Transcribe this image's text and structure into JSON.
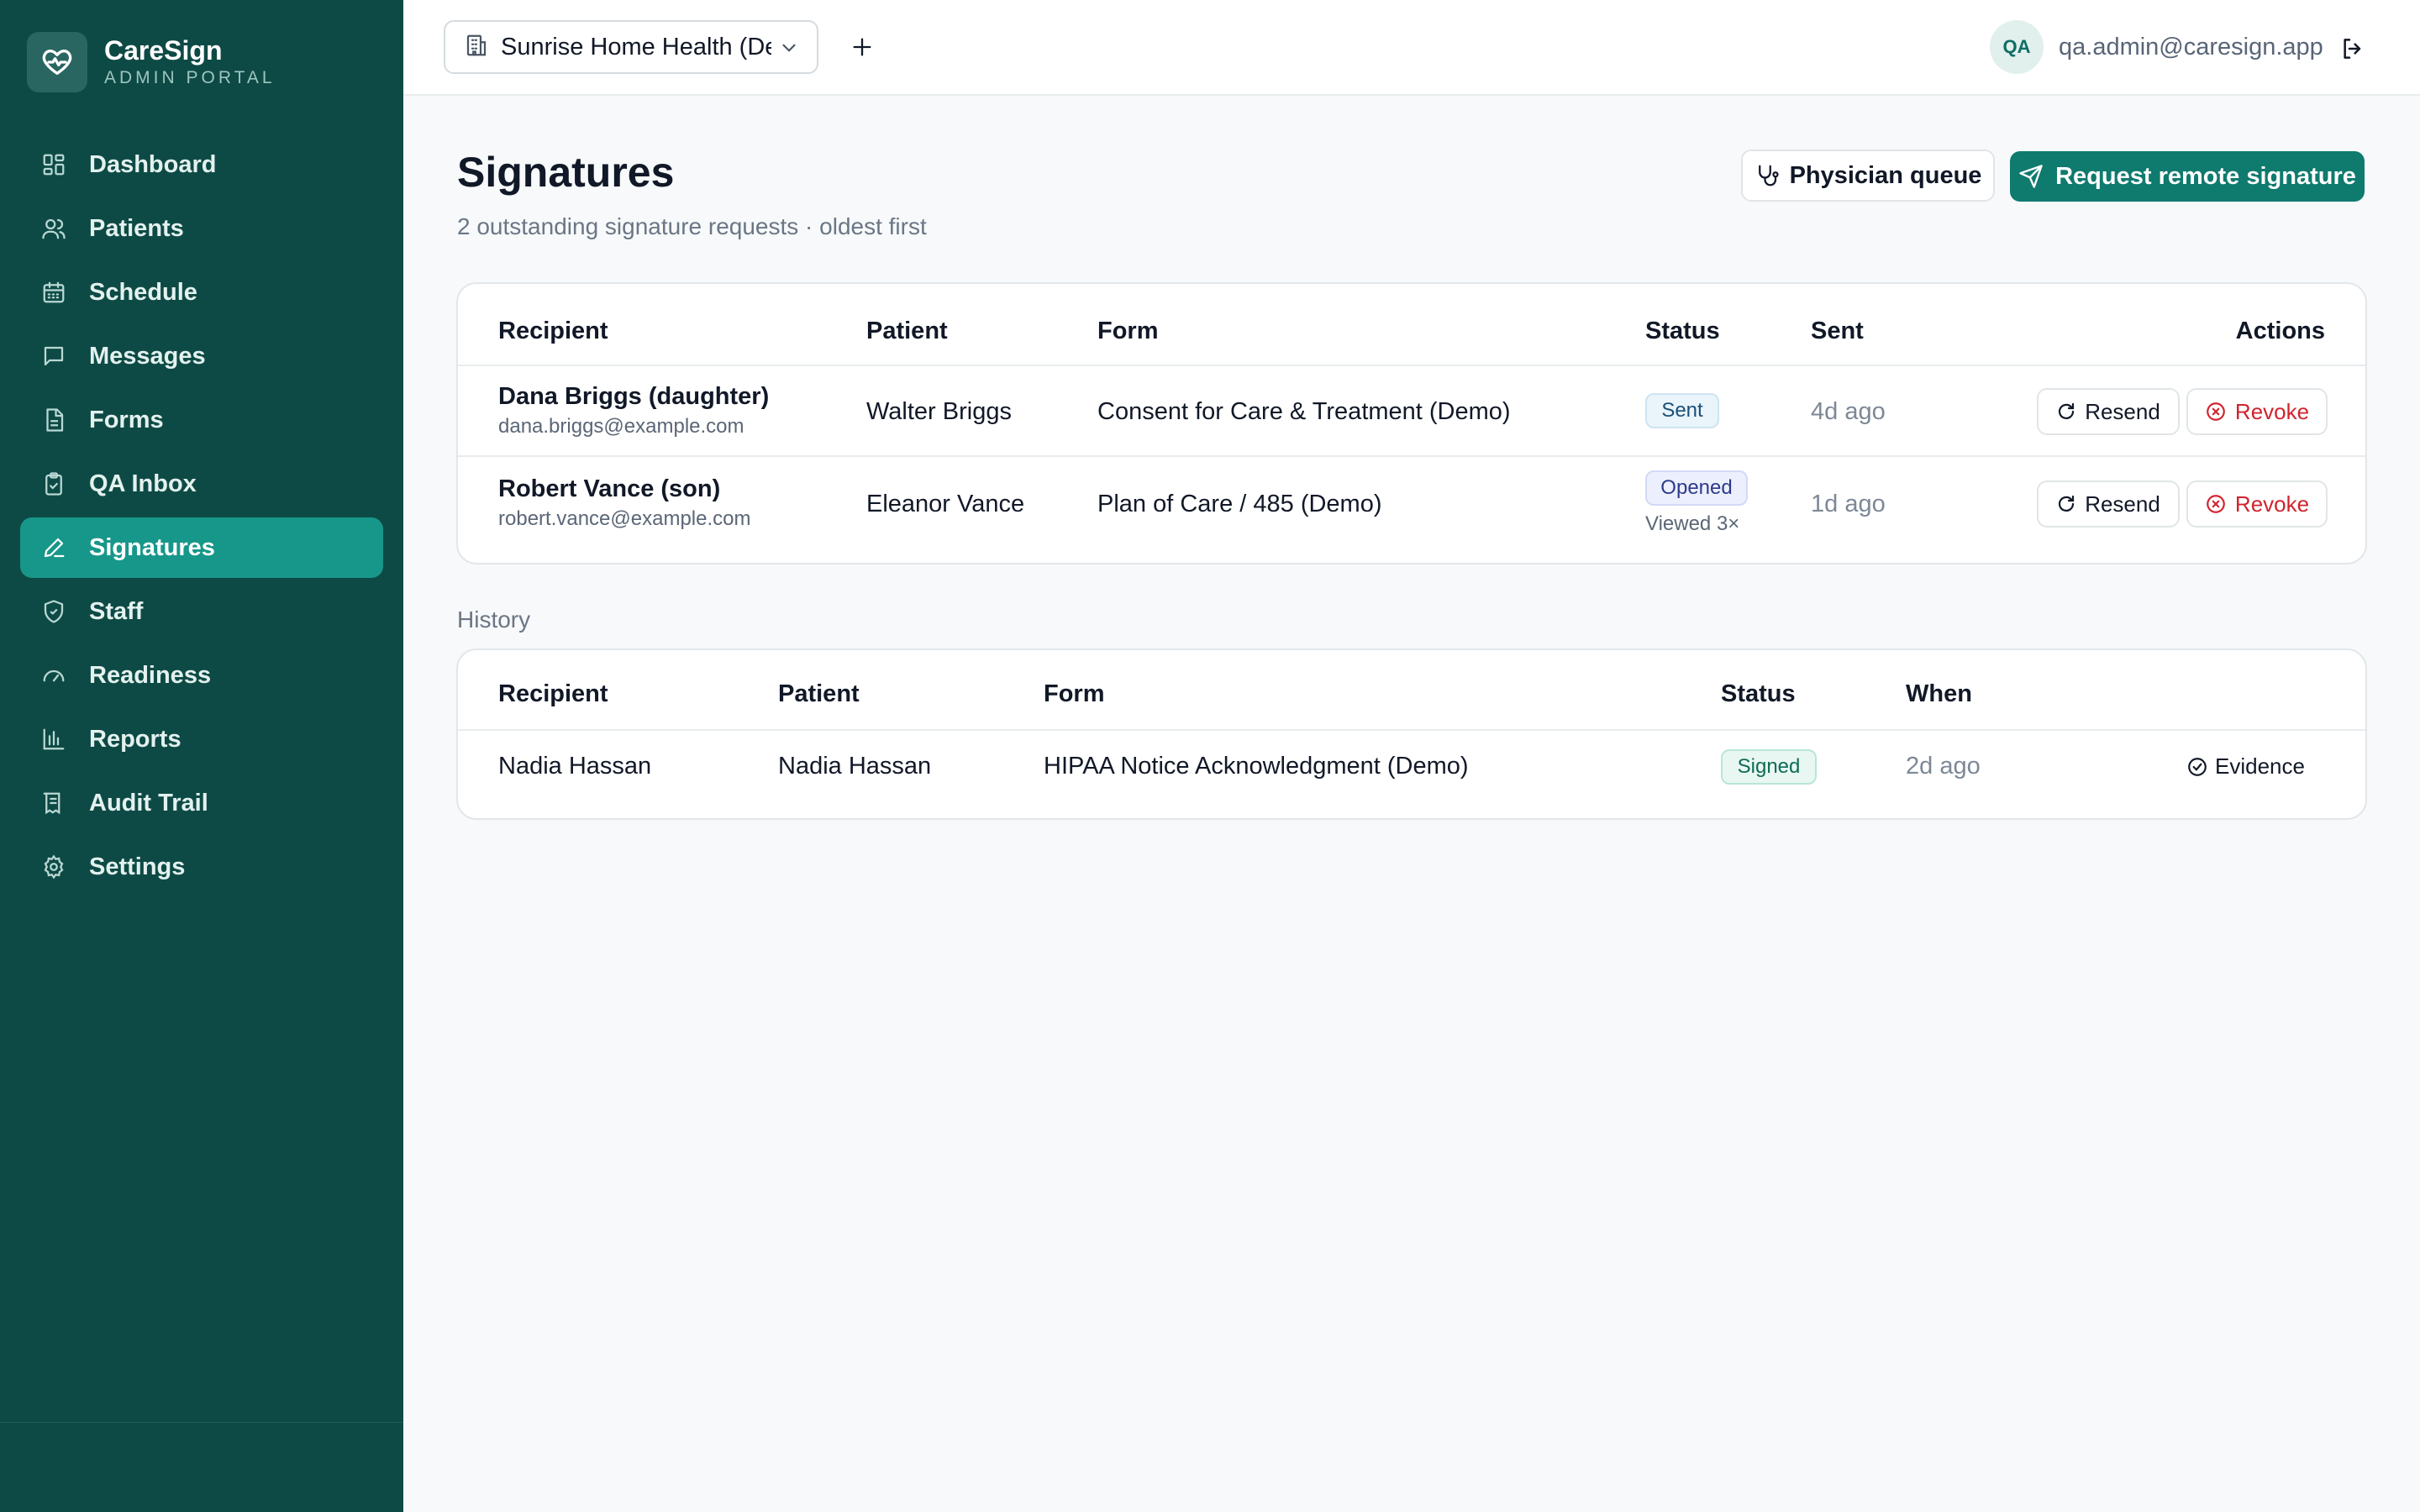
{
  "brand": {
    "name": "CareSign",
    "subtitle": "ADMIN PORTAL"
  },
  "sidebar": {
    "items": [
      {
        "label": "Dashboard",
        "icon": "dashboard-grid-icon",
        "active": false
      },
      {
        "label": "Patients",
        "icon": "users-icon",
        "active": false
      },
      {
        "label": "Schedule",
        "icon": "calendar-icon",
        "active": false
      },
      {
        "label": "Messages",
        "icon": "message-icon",
        "active": false
      },
      {
        "label": "Forms",
        "icon": "document-icon",
        "active": false
      },
      {
        "label": "QA Inbox",
        "icon": "clipboard-check-icon",
        "active": false
      },
      {
        "label": "Signatures",
        "icon": "pen-icon",
        "active": true
      },
      {
        "label": "Staff",
        "icon": "shield-check-icon",
        "active": false
      },
      {
        "label": "Readiness",
        "icon": "gauge-icon",
        "active": false
      },
      {
        "label": "Reports",
        "icon": "bar-chart-icon",
        "active": false
      },
      {
        "label": "Audit Trail",
        "icon": "receipt-icon",
        "active": false
      },
      {
        "label": "Settings",
        "icon": "gear-icon",
        "active": false
      }
    ]
  },
  "topbar": {
    "org_selected": "Sunrise Home Health (De",
    "user_initials": "QA",
    "user_email": "qa.admin@caresign.app"
  },
  "page": {
    "title": "Signatures",
    "subtitle": "2 outstanding signature requests · oldest first",
    "physician_queue_label": "Physician queue",
    "request_label": "Request remote signature"
  },
  "outstanding": {
    "headers": {
      "recipient": "Recipient",
      "patient": "Patient",
      "form": "Form",
      "status": "Status",
      "sent": "Sent",
      "actions": "Actions"
    },
    "rows": [
      {
        "recipient": "Dana Briggs (daughter)",
        "email": "dana.briggs@example.com",
        "patient": "Walter Briggs",
        "form": "Consent for Care & Treatment (Demo)",
        "status": "Sent",
        "status_note": "",
        "sent": "4d ago",
        "resend": "Resend",
        "revoke": "Revoke"
      },
      {
        "recipient": "Robert Vance (son)",
        "email": "robert.vance@example.com",
        "patient": "Eleanor Vance",
        "form": "Plan of Care / 485 (Demo)",
        "status": "Opened",
        "status_note": "Viewed 3×",
        "sent": "1d ago",
        "resend": "Resend",
        "revoke": "Revoke"
      }
    ]
  },
  "history": {
    "label": "History",
    "headers": {
      "recipient": "Recipient",
      "patient": "Patient",
      "form": "Form",
      "status": "Status",
      "when": "When"
    },
    "rows": [
      {
        "recipient": "Nadia Hassan",
        "patient": "Nadia Hassan",
        "form": "HIPAA Notice Acknowledgment (Demo)",
        "status": "Signed",
        "when": "2d ago",
        "evidence": "Evidence"
      }
    ]
  },
  "colors": {
    "sidebar_bg": "#0e4a45",
    "active_nav": "#17978a",
    "primary": "#0f7a6e",
    "danger": "#d0242e"
  }
}
